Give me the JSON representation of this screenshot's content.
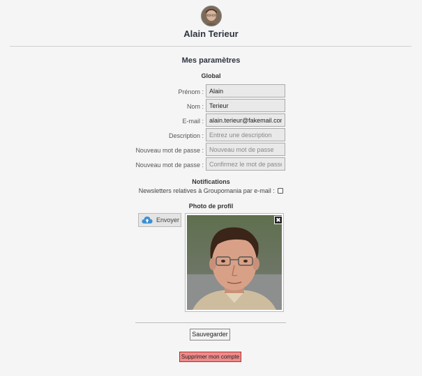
{
  "header": {
    "user_name": "Alain Terieur"
  },
  "settings": {
    "title": "Mes paramètres",
    "global_title": "Global",
    "fields": [
      {
        "label": "Prénom :",
        "value": "Alain",
        "placeholder": ""
      },
      {
        "label": "Nom :",
        "value": "Terieur",
        "placeholder": ""
      },
      {
        "label": "E-mail :",
        "value": "alain.terieur@fakemail.com",
        "placeholder": ""
      },
      {
        "label": "Description :",
        "value": "",
        "placeholder": "Entrez une description"
      },
      {
        "label": "Nouveau mot de passe :",
        "value": "",
        "placeholder": "Nouveau mot de passe"
      },
      {
        "label": "Nouveau mot de passe :",
        "value": "",
        "placeholder": "Confirmez le mot de passe"
      }
    ]
  },
  "notifications": {
    "title": "Notifications",
    "newsletter_label": "Newsletters relatives à Groupomania par e-mail :",
    "newsletter_checked": false
  },
  "photo": {
    "title": "Photo de profil",
    "upload_label": "Envoyer",
    "remove_symbol": "✖"
  },
  "actions": {
    "save_label": "Sauvegarder",
    "delete_label": "Supprimer mon compte"
  },
  "colors": {
    "delete_bg": "#f08a8a",
    "upload_icon": "#3a8fd6"
  }
}
